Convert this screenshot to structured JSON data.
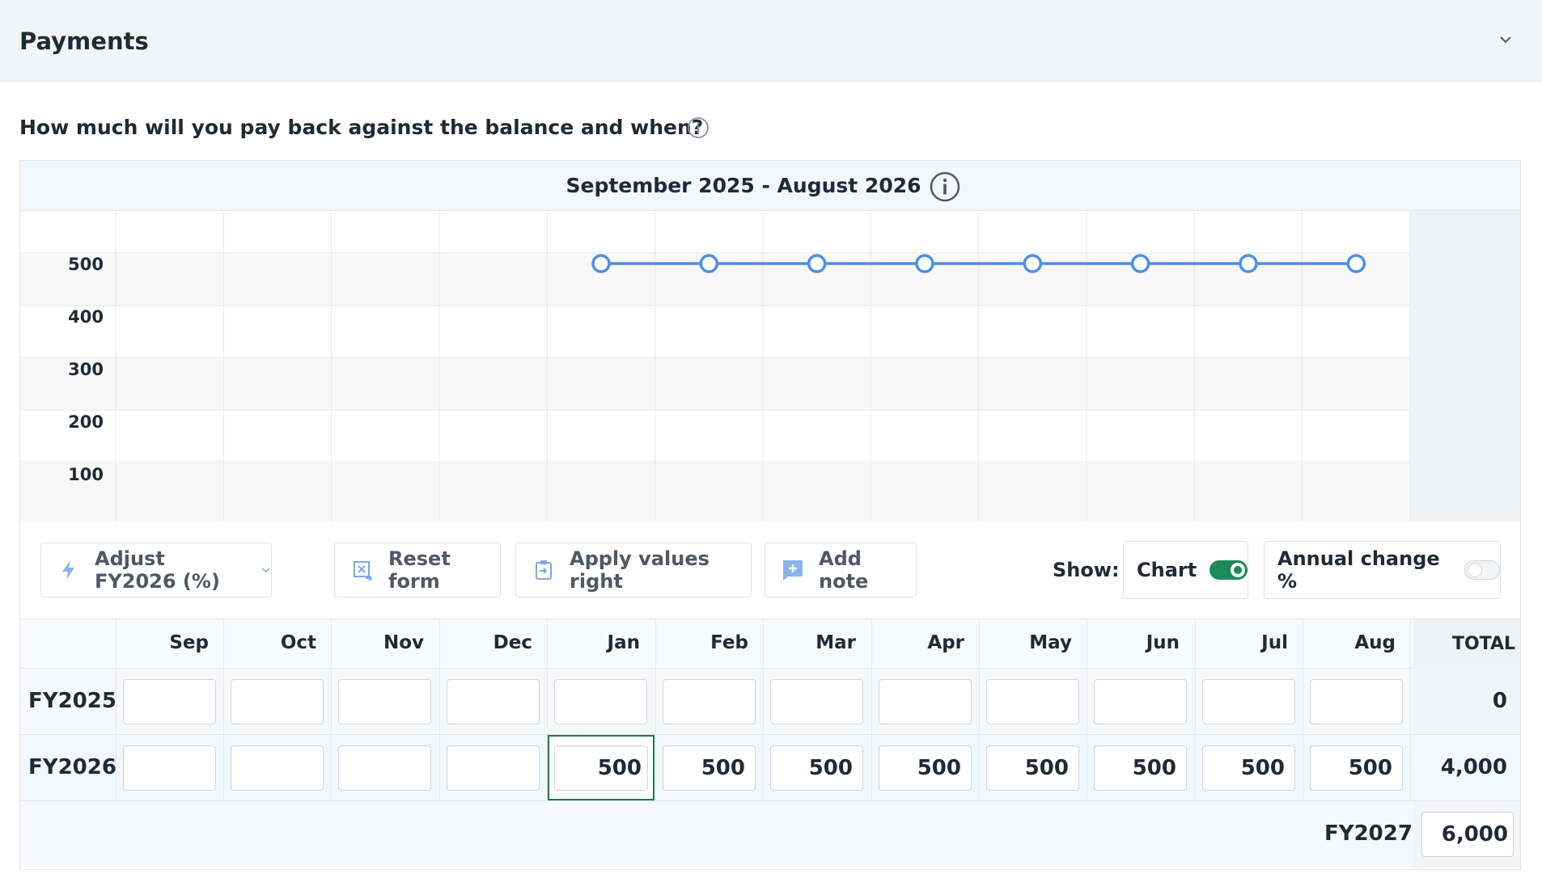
{
  "section": {
    "title": "Payments"
  },
  "question": "How much will you pay back against the balance and when?",
  "period_title": "September 2025 - August 2026",
  "chart_data": {
    "type": "line",
    "categories": [
      "Sep",
      "Oct",
      "Nov",
      "Dec",
      "Jan",
      "Feb",
      "Mar",
      "Apr",
      "May",
      "Jun",
      "Jul",
      "Aug"
    ],
    "series": [
      {
        "values": [
          null,
          null,
          null,
          null,
          500,
          500,
          500,
          500,
          500,
          500,
          500,
          500
        ],
        "color": "#4a90e2"
      }
    ],
    "yticks": [
      "500",
      "400",
      "300",
      "200",
      "100"
    ],
    "ylim": [
      0,
      600
    ],
    "grid": true
  },
  "toolbar": {
    "adjust_label": "Adjust FY2026 (%)",
    "reset_label": "Reset form",
    "apply_label": "Apply values right",
    "note_label": "Add note",
    "show_label": "Show:",
    "chart_toggle": {
      "label": "Chart",
      "on": true
    },
    "annual_toggle": {
      "label": "Annual change %",
      "on": false
    }
  },
  "table": {
    "months": [
      "Sep",
      "Oct",
      "Nov",
      "Dec",
      "Jan",
      "Feb",
      "Mar",
      "Apr",
      "May",
      "Jun",
      "Jul",
      "Aug"
    ],
    "total_header": "TOTAL",
    "rows": [
      {
        "label": "FY2025",
        "values": [
          "",
          "",
          "",
          "",
          "",
          "",
          "",
          "",
          "",
          "",
          "",
          ""
        ],
        "total": "0"
      },
      {
        "label": "FY2026",
        "values": [
          "",
          "",
          "",
          "",
          "500",
          "500",
          "500",
          "500",
          "500",
          "500",
          "500",
          "500"
        ],
        "total": "4,000"
      }
    ],
    "footer": {
      "label": "FY2027",
      "value": "6,000"
    }
  },
  "colors": {
    "accent": "#4a90e2",
    "toggle_on": "#1b8a5a",
    "focus": "#1b7a4e"
  }
}
